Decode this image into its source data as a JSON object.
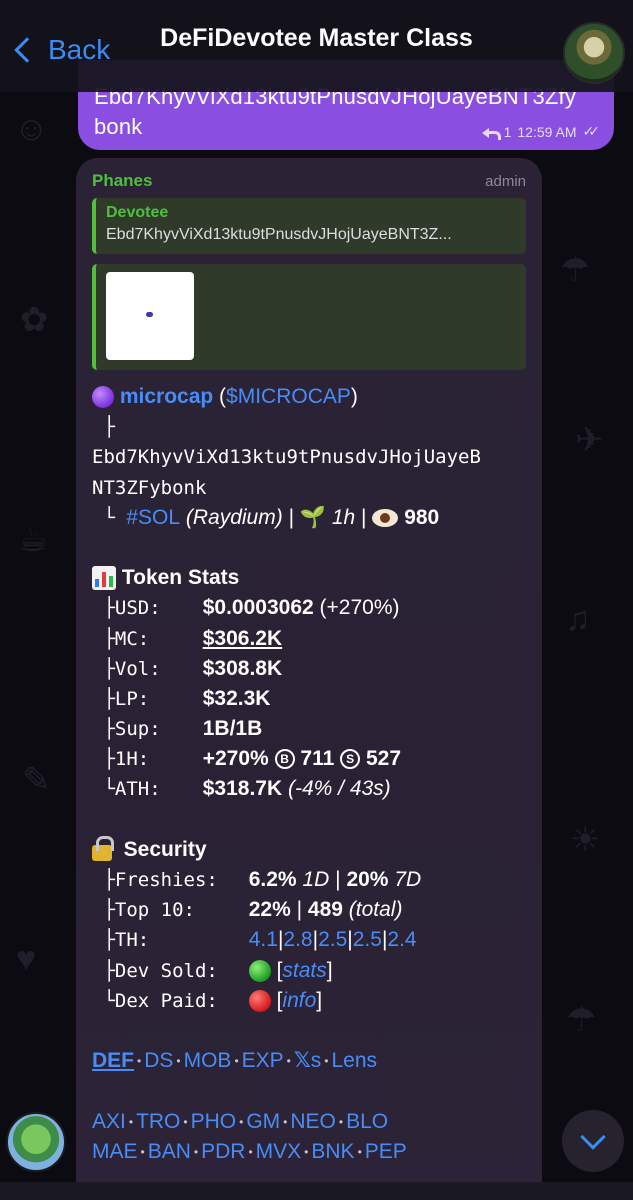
{
  "header": {
    "back_label": "Back",
    "title": "DeFiDevotee Master Class"
  },
  "outgoing": {
    "text_line1": "Ebd7KhyvViXd13ktu9tPnusdvJHojUayeBNT3Zfy",
    "text_line2": "bonk",
    "reply_count": "1",
    "time": "12:59 AM"
  },
  "message": {
    "sender": "Phanes",
    "role": "admin",
    "quote": {
      "name": "Devotee",
      "text": "Ebd7KhyvViXd13ktu9tPnusdvJHojUayeBNT3Z..."
    },
    "token_name": "microcap",
    "ticker": "$MICROCAP",
    "address_line1": "Ebd7KhyvViXd13ktu9tPnusdvJHojUayeB",
    "address_line2": "NT3ZFybonk",
    "chain": "#SOL",
    "dex": "(Raydium)",
    "age": "1h",
    "views": "980",
    "stats_title": "Token Stats",
    "stats": {
      "usd_label": "USD:",
      "usd_value": "$0.0003062",
      "usd_change": "(+270%)",
      "mc_label": "MC:",
      "mc_value": "$306.2K",
      "vol_label": "Vol:",
      "vol_value": "$308.8K",
      "lp_label": "LP:",
      "lp_value": "$32.3K",
      "sup_label": "Sup:",
      "sup_value": "1B/1B",
      "h1_label": "1H:",
      "h1_value": "+270%",
      "h1_buys": "711",
      "h1_sells": "527",
      "ath_label": "ATH:",
      "ath_value": "$318.7K",
      "ath_detail": "(-4% / 43s)"
    },
    "security_title": "Security",
    "security": {
      "freshies_label": "Freshies:",
      "freshies_1d": "6.2%",
      "freshies_1d_unit": "1D",
      "freshies_7d": "20%",
      "freshies_7d_unit": "7D",
      "top10_label": "Top 10:",
      "top10_pct": "22%",
      "top10_total": "489",
      "top10_total_label": "(total)",
      "th_label": "TH:",
      "th_values": [
        "4.1",
        "2.8",
        "2.5",
        "2.5",
        "2.4"
      ],
      "dev_sold_label": "Dev Sold:",
      "dev_sold_link": "stats",
      "dex_paid_label": "Dex Paid:",
      "dex_paid_link": "info"
    },
    "links_row1": [
      "DEF",
      "DS",
      "MOB",
      "EXP",
      "s",
      "Lens"
    ],
    "links_row2": [
      "AXI",
      "TRO",
      "PHO",
      "GM",
      "NEO",
      "BLO"
    ],
    "links_row3": [
      "MAE",
      "BAN",
      "PDR",
      "MVX",
      "BNK",
      "PEP"
    ]
  },
  "colors": {
    "accent": "#3a8cf5",
    "outgoing_bubble": "#8a4fe0",
    "sender_green": "#4fbf3c",
    "link_blue": "#4a8cf5"
  }
}
